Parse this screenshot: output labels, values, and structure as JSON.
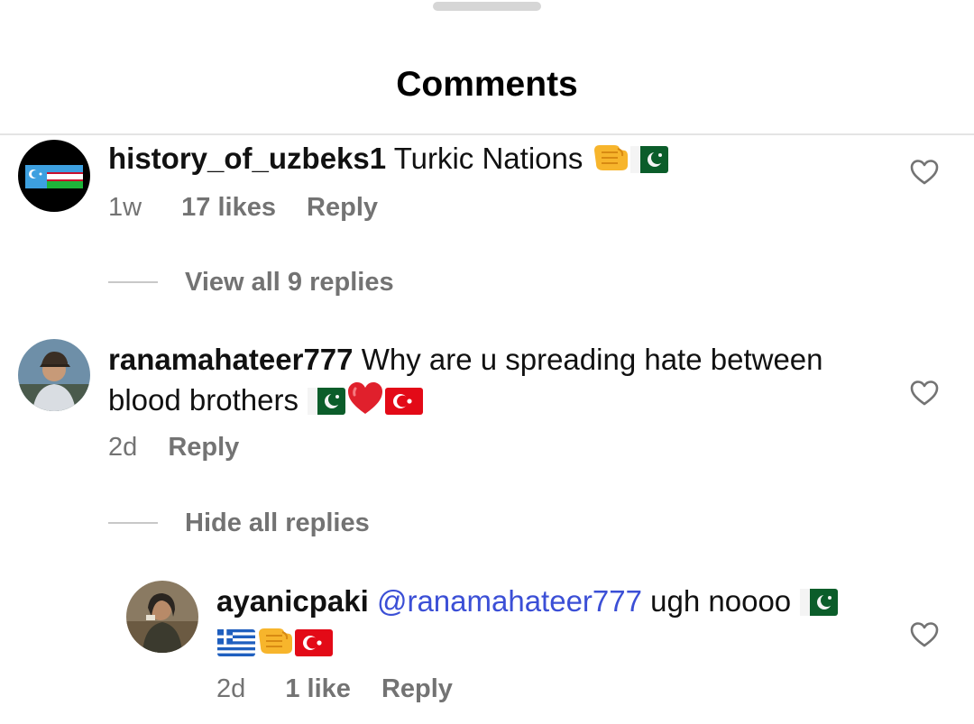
{
  "header": {
    "title": "Comments"
  },
  "comments": [
    {
      "username": "history_of_uzbeks1",
      "text": "Turkic Nations",
      "emojis": [
        "fist-emoji",
        "flag-pakistan"
      ],
      "time": "1w",
      "likes": "17 likes",
      "reply": "Reply",
      "replies_toggle": "View all 9 replies"
    },
    {
      "username": "ranamahateer777",
      "text_line1": "Why are u spreading hate between",
      "text_line2": "blood brothers",
      "emojis": [
        "flag-pakistan",
        "red-heart",
        "flag-turkey"
      ],
      "time": "2d",
      "reply": "Reply",
      "replies_toggle": "Hide all replies",
      "replies": [
        {
          "username": "ayanicpaki",
          "mention": "@ranamahateer777",
          "text": "ugh noooo",
          "emojis": [
            "flag-pakistan",
            "flag-greece",
            "fist-emoji",
            "flag-turkey"
          ],
          "time": "2d",
          "likes": "1 like",
          "reply": "Reply"
        }
      ]
    }
  ],
  "colors": {
    "text": "#111111",
    "meta": "#737373",
    "mention": "#3b4fd6",
    "divider": "#e4e4e4"
  }
}
